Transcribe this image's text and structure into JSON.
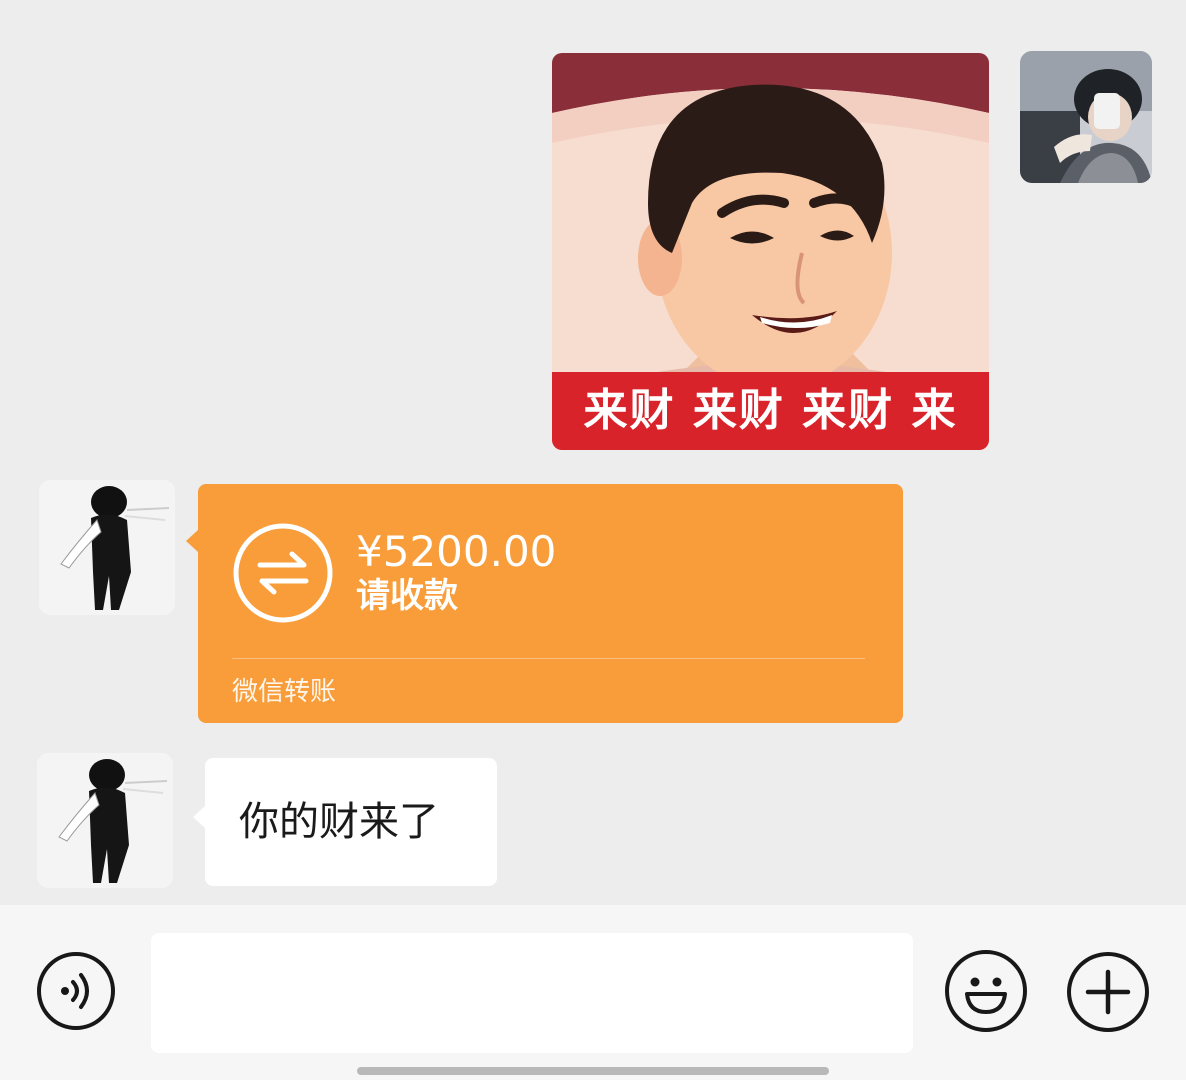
{
  "sticker": {
    "caption": "来财 来财 来财 来"
  },
  "transfer": {
    "amount": "¥5200.00",
    "status": "请收款",
    "footer": "微信转账"
  },
  "message": {
    "text": "你的财来了"
  },
  "input": {
    "placeholder": ""
  },
  "icons": {
    "voice": "voice-icon",
    "emoji": "emoji-icon",
    "plus": "plus-icon",
    "transfer": "transfer-arrows-icon"
  },
  "colors": {
    "background": "#ededed",
    "transfer_orange": "#f89d3a",
    "sticker_red": "#d8232a",
    "bubble": "#ffffff"
  }
}
